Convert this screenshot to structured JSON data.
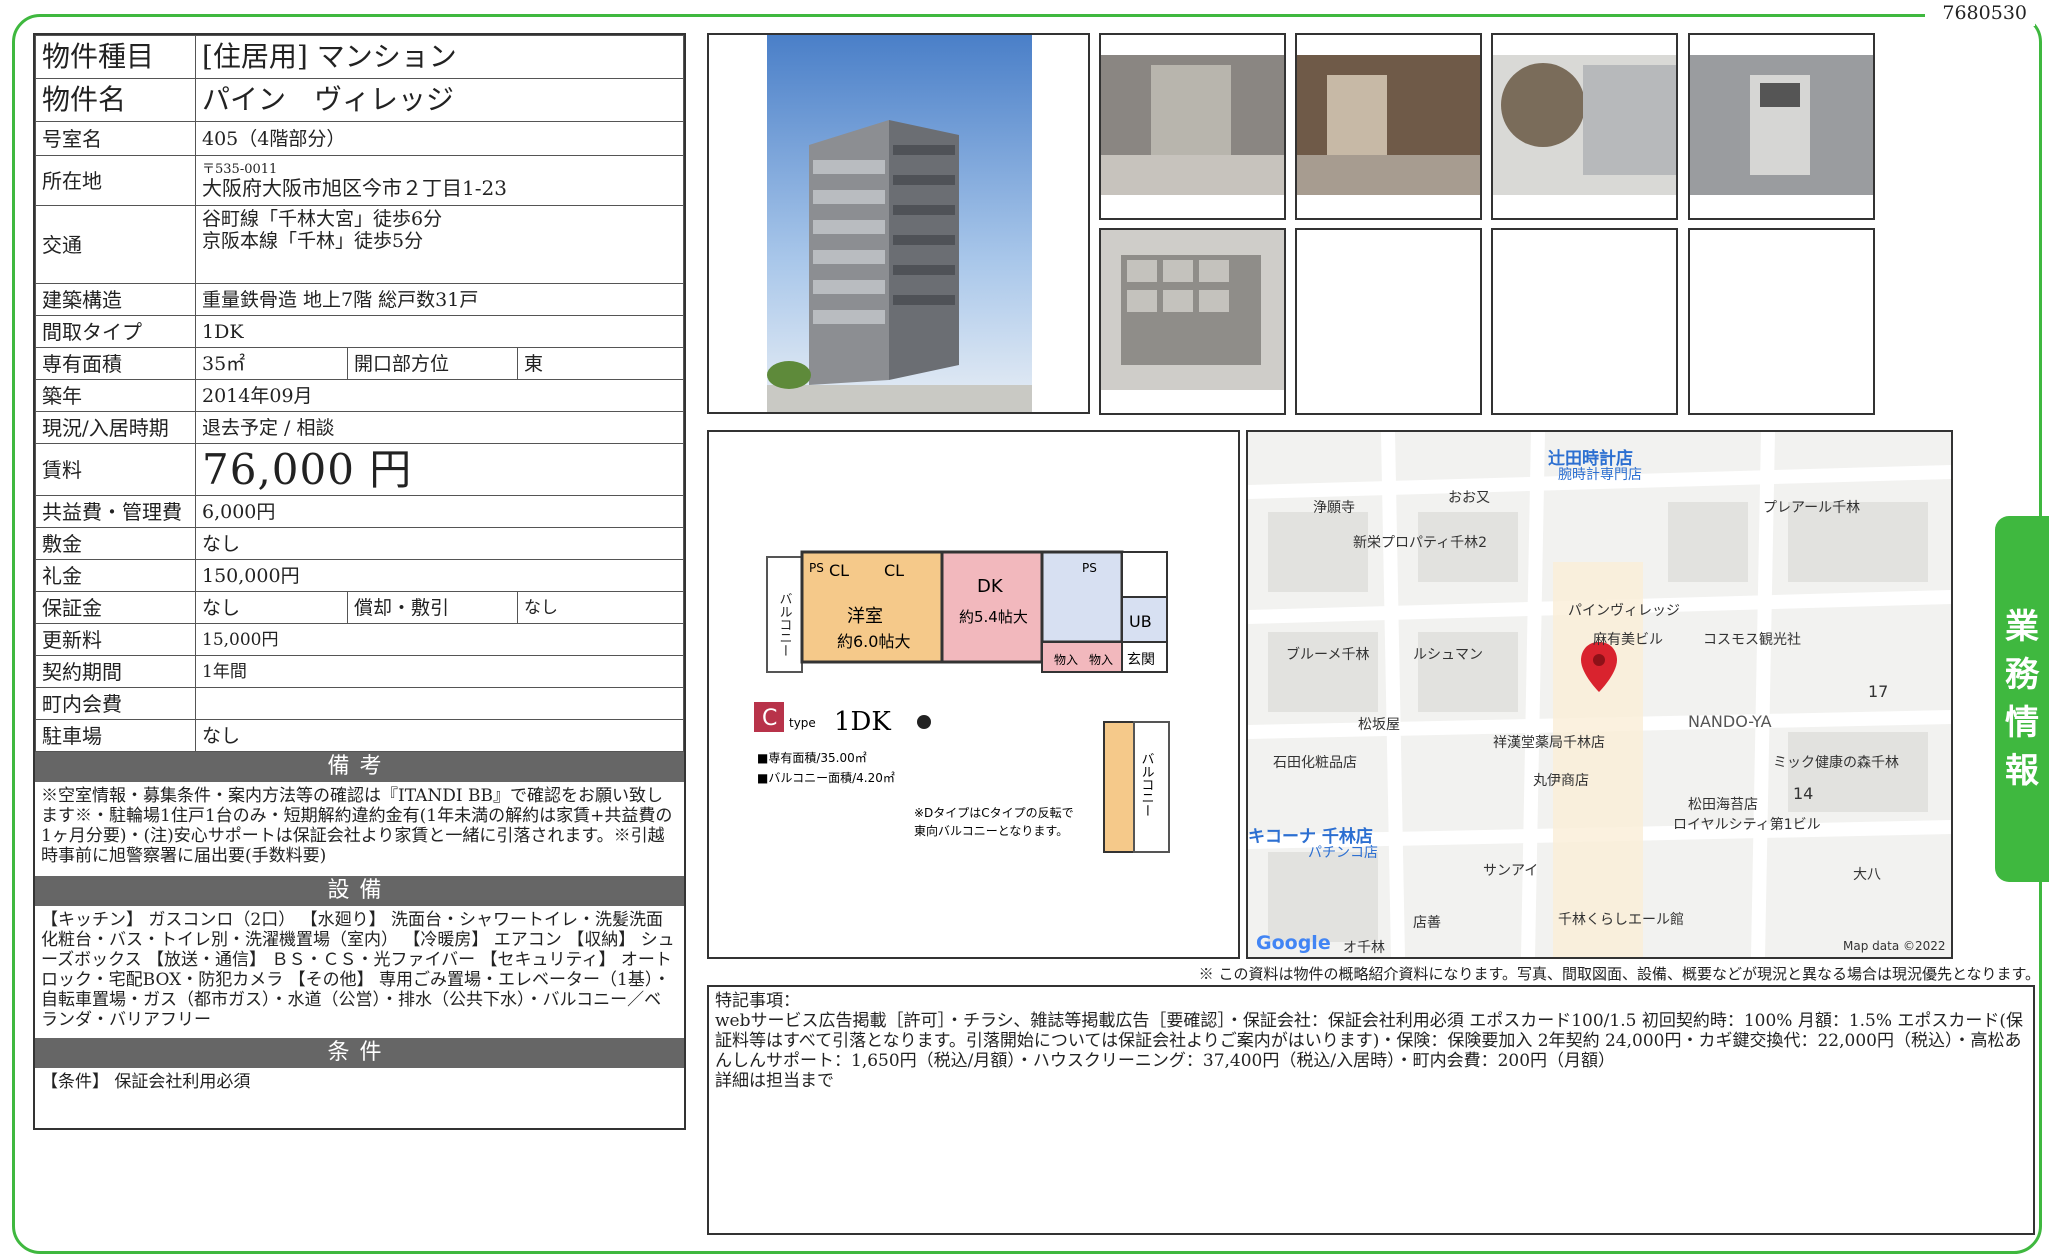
{
  "doc_number": "7680530",
  "side_tab": [
    "業",
    "務",
    "情",
    "報"
  ],
  "property": {
    "type_label": "物件種目",
    "type_value": "[住居用] マンション",
    "name_label": "物件名",
    "name_value": "パイン　ヴィレッジ",
    "room_label": "号室名",
    "room_value": "405（4階部分）",
    "address_label": "所在地",
    "postal": "〒535-0011",
    "address": "大阪府大阪市旭区今市２丁目1-23",
    "transport_label": "交通",
    "transport_1": "谷町線「千林大宮」徒歩6分",
    "transport_2": "京阪本線「千林」徒歩5分",
    "structure_label": "建築構造",
    "structure_value": "重量鉄骨造 地上7階 総戸数31戸",
    "layout_label": "間取タイプ",
    "layout_value": "1DK",
    "area_label": "専有面積",
    "area_value": "35㎡",
    "direction_label": "開口部方位",
    "direction_value": "東",
    "built_label": "築年",
    "built_value": "2014年09月",
    "status_label": "現況/入居時期",
    "status_value": "退去予定 /  相談",
    "rent_label": "賃料",
    "rent_value": "76,000 円",
    "fee_label": "共益費・管理費",
    "fee_value": "6,000円",
    "deposit_label": "敷金",
    "deposit_value": "なし",
    "key_money_label": "礼金",
    "key_money_value": "150,000円",
    "guarantee_label": "保証金",
    "guarantee_value": "なし",
    "amort_label": "償却・敷引",
    "amort_value": "なし",
    "renewal_label": "更新料",
    "renewal_value": "15,000円",
    "contract_label": "契約期間",
    "contract_value": "1年間",
    "community_label": "町内会費",
    "community_value": "",
    "parking_label": "駐車場",
    "parking_value": "なし"
  },
  "notes_head": "備考",
  "notes_text": "※空室情報・募集条件・案内方法等の確認は『ITANDI BB』で確認をお願い致します※・駐輪場1住戸1台のみ・短期解約違約金有(1年未満の解約は家賃+共益費の1ヶ月分要)・(注)安心サポートは保証会社より家賃と一緒に引落されます。※引越時事前に旭警察署に届出要(手数料要)",
  "facilities_head": "設備",
  "facilities_text": "【キッチン】 ガスコンロ（2口） 【水廻り】 洗面台・シャワートイレ・洗髪洗面化粧台・バス・トイレ別・洗濯機置場（室内） 【冷暖房】 エアコン 【収納】 シューズボックス 【放送・通信】 ＢＳ・ＣＳ・光ファイバー 【セキュリティ】 オートロック・宅配BOX・防犯カメラ 【その他】 専用ごみ置場・エレベーター（1基）・自転車置場・ガス（都市ガス）・水道（公営）・排水（公共下水）・バルコニー／ベランダ・バリアフリー",
  "conditions_head": "条件",
  "conditions_text": "【条件】 保証会社利用必須",
  "floorplan": {
    "rooms": [
      "洋室",
      "約6.0帖大",
      "DK",
      "約5.4帖大",
      "CL",
      "CL",
      "PS",
      "PS",
      "UB",
      "玄関",
      "物入",
      "物入",
      "バルコニー",
      "バルコニー"
    ],
    "type_letter": "C",
    "type_word": "type",
    "layout": "1DK",
    "area_line": "■専有面積/35.00㎡",
    "balcony_line": "■バルコニー面積/4.20㎡",
    "note_1": "※DタイプはCタイプの反転で",
    "note_2": "東向バルコニーとなります。"
  },
  "map": {
    "labels": [
      "辻田時計店",
      "腕時計専門店",
      "浄願寺",
      "おお又",
      "プレアール千林",
      "新栄プロパティ千林2",
      "パインヴィレッジ",
      "麻有美ビル",
      "コスモス観光社",
      "ブルーメ千林",
      "ルシュマン",
      "NANDO-YA",
      "17",
      "松坂屋",
      "祥漢堂薬局千林店",
      "石田化粧品店",
      "丸伊商店",
      "ミック健康の森千林",
      "14",
      "松田海苔店",
      "ロイヤルシティ第1ビル",
      "キコーナ 千林店",
      "パチンコ店",
      "サンアイ",
      "大八",
      "店善",
      "千林くらしエール館",
      "Google",
      "オ千林",
      "Map data ©2022"
    ]
  },
  "disclaimer": "※ この資料は物件の概略紹介資料になります。写真、間取図面、設備、概要などが現況と異なる場合は現況優先となります。",
  "remarks": {
    "title": "特記事項：",
    "line1": "webサービス広告掲載［許可］・チラシ、雑誌等掲載広告［要確認］・保証会社：保証会社利用必須 エポスカード100/1.5 初回契約時：100% 月額：1.5% エポスカード(保証料等はすべて引落となります。引落開始については保証会社よりご案内がはいります)・保険：保険要加入 2年契約 24,000円・カギ鍵交換代：22,000円（税込）・高松あんしんサポート：1,650円（税込/月額）・ハウスクリーニング：37,400円（税込/入居時）・町内会費：200円（月額）",
    "line2": "詳細は担当まで"
  },
  "colors": {
    "accent": "#3fb83f",
    "section_head": "#666666",
    "map_pin": "#d9232e"
  }
}
